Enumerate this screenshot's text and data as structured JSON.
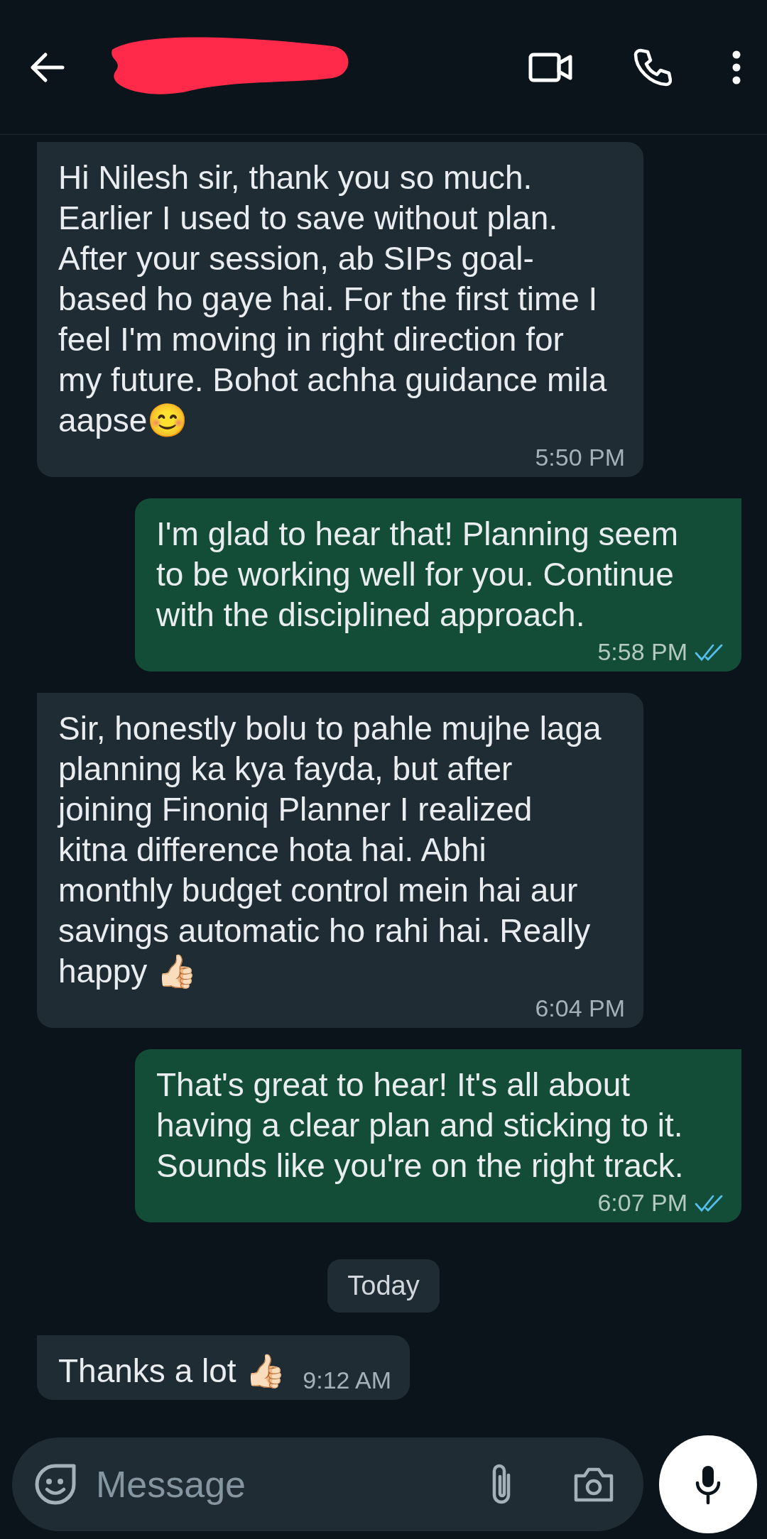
{
  "messages": [
    {
      "kind": "incoming",
      "text": "Hi Nilesh sir, thank you so much. Earlier I used to save without plan. After your session, ab SIPs goal-based ho gaye hai. For the first time I feel I'm moving in right direction for my future. Bohot achha guidance mila aapse😊",
      "time": "5:50 PM"
    },
    {
      "kind": "outgoing",
      "text": "I'm glad to hear that! Planning seem to be working well for you. Continue with the disciplined approach.",
      "time": "5:58 PM",
      "read": true
    },
    {
      "kind": "incoming",
      "text": "Sir, honestly bolu to pahle mujhe laga planning ka kya fayda, but after joining Finoniq Planner I realized kitna difference hota hai. Abhi monthly budget control mein hai aur savings automatic ho rahi hai. Really happy 👍🏻",
      "time": "6:04 PM"
    },
    {
      "kind": "outgoing",
      "text": "That's great to hear! It's all about having a clear plan and sticking to it. Sounds like you're on the right track.",
      "time": "6:07 PM",
      "read": true
    },
    {
      "kind": "date",
      "text": "Today"
    },
    {
      "kind": "incoming",
      "text": "Thanks a lot 👍🏻",
      "time": "9:12 AM"
    }
  ],
  "composer": {
    "placeholder": "Message"
  }
}
